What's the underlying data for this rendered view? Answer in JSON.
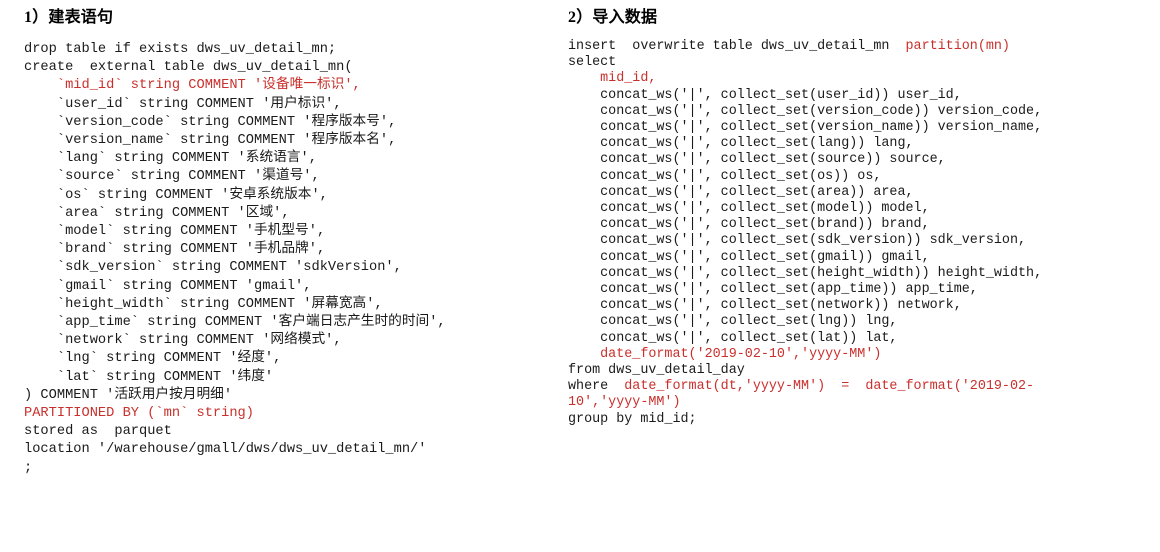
{
  "left": {
    "heading": "1）建表语句",
    "code_lines": [
      {
        "text": "drop table if exists dws_uv_detail_mn;",
        "color": "black"
      },
      {
        "text": "create  external table dws_uv_detail_mn(",
        "color": "black"
      },
      {
        "text": "    `mid_id` string COMMENT '设备唯一标识',",
        "color": "red"
      },
      {
        "text": "    `user_id` string COMMENT '用户标识',",
        "color": "black"
      },
      {
        "text": "    `version_code` string COMMENT '程序版本号',",
        "color": "black"
      },
      {
        "text": "    `version_name` string COMMENT '程序版本名',",
        "color": "black"
      },
      {
        "text": "    `lang` string COMMENT '系统语言',",
        "color": "black"
      },
      {
        "text": "    `source` string COMMENT '渠道号',",
        "color": "black"
      },
      {
        "text": "    `os` string COMMENT '安卓系统版本',",
        "color": "black"
      },
      {
        "text": "    `area` string COMMENT '区域',",
        "color": "black"
      },
      {
        "text": "    `model` string COMMENT '手机型号',",
        "color": "black"
      },
      {
        "text": "    `brand` string COMMENT '手机品牌',",
        "color": "black"
      },
      {
        "text": "    `sdk_version` string COMMENT 'sdkVersion',",
        "color": "black"
      },
      {
        "text": "    `gmail` string COMMENT 'gmail',",
        "color": "black"
      },
      {
        "text": "    `height_width` string COMMENT '屏幕宽高',",
        "color": "black"
      },
      {
        "text": "    `app_time` string COMMENT '客户端日志产生时的时间',",
        "color": "black"
      },
      {
        "text": "    `network` string COMMENT '网络模式',",
        "color": "black"
      },
      {
        "text": "    `lng` string COMMENT '经度',",
        "color": "black"
      },
      {
        "text": "    `lat` string COMMENT '纬度'",
        "color": "black"
      },
      {
        "text": ") COMMENT '活跃用户按月明细'",
        "color": "black"
      },
      {
        "text": "PARTITIONED BY (`mn` string)",
        "color": "red"
      },
      {
        "text": "stored as  parquet",
        "color": "black"
      },
      {
        "text": "location '/warehouse/gmall/dws/dws_uv_detail_mn/'",
        "color": "black"
      },
      {
        "text": ";",
        "color": "black"
      }
    ]
  },
  "right": {
    "heading": "2）导入数据",
    "code_lines": [
      {
        "segments": [
          {
            "t": "insert  overwrite table dws_uv_detail_mn  ",
            "c": "black"
          },
          {
            "t": "partition(mn)",
            "c": "red"
          }
        ]
      },
      {
        "segments": [
          {
            "t": "select",
            "c": "black"
          }
        ]
      },
      {
        "segments": [
          {
            "t": "    mid_id,",
            "c": "red"
          }
        ]
      },
      {
        "segments": [
          {
            "t": "    concat_ws('|', collect_set(user_id)) user_id,",
            "c": "black"
          }
        ]
      },
      {
        "segments": [
          {
            "t": "    concat_ws('|', collect_set(version_code)) version_code,",
            "c": "black"
          }
        ]
      },
      {
        "segments": [
          {
            "t": "    concat_ws('|', collect_set(version_name)) version_name,",
            "c": "black"
          }
        ]
      },
      {
        "segments": [
          {
            "t": "    concat_ws('|', collect_set(lang)) lang,",
            "c": "black"
          }
        ]
      },
      {
        "segments": [
          {
            "t": "    concat_ws('|', collect_set(source)) source,",
            "c": "black"
          }
        ]
      },
      {
        "segments": [
          {
            "t": "    concat_ws('|', collect_set(os)) os,",
            "c": "black"
          }
        ]
      },
      {
        "segments": [
          {
            "t": "    concat_ws('|', collect_set(area)) area,",
            "c": "black"
          }
        ]
      },
      {
        "segments": [
          {
            "t": "    concat_ws('|', collect_set(model)) model,",
            "c": "black"
          }
        ]
      },
      {
        "segments": [
          {
            "t": "    concat_ws('|', collect_set(brand)) brand,",
            "c": "black"
          }
        ]
      },
      {
        "segments": [
          {
            "t": "    concat_ws('|', collect_set(sdk_version)) sdk_version,",
            "c": "black"
          }
        ]
      },
      {
        "segments": [
          {
            "t": "    concat_ws('|', collect_set(gmail)) gmail,",
            "c": "black"
          }
        ]
      },
      {
        "segments": [
          {
            "t": "    concat_ws('|', collect_set(height_width)) height_width,",
            "c": "black"
          }
        ]
      },
      {
        "segments": [
          {
            "t": "    concat_ws('|', collect_set(app_time)) app_time,",
            "c": "black"
          }
        ]
      },
      {
        "segments": [
          {
            "t": "    concat_ws('|', collect_set(network)) network,",
            "c": "black"
          }
        ]
      },
      {
        "segments": [
          {
            "t": "    concat_ws('|', collect_set(lng)) lng,",
            "c": "black"
          }
        ]
      },
      {
        "segments": [
          {
            "t": "    concat_ws('|', collect_set(lat)) lat,",
            "c": "black"
          }
        ]
      },
      {
        "segments": [
          {
            "t": "    date_format('2019-02-10','yyyy-MM')",
            "c": "red"
          }
        ]
      },
      {
        "segments": [
          {
            "t": "from dws_uv_detail_day",
            "c": "black"
          }
        ]
      },
      {
        "segments": [
          {
            "t": "where  ",
            "c": "black"
          },
          {
            "t": "date_format(dt,'yyyy-MM')  =  date_format('2019-02-",
            "c": "red"
          }
        ]
      },
      {
        "segments": [
          {
            "t": "10','yyyy-MM')",
            "c": "red"
          }
        ]
      },
      {
        "segments": [
          {
            "t": "group by mid_id;",
            "c": "black"
          }
        ]
      }
    ]
  },
  "colors": {
    "text": "#1a1a1a",
    "accent_red": "#c9302c",
    "background": "#ffffff"
  }
}
